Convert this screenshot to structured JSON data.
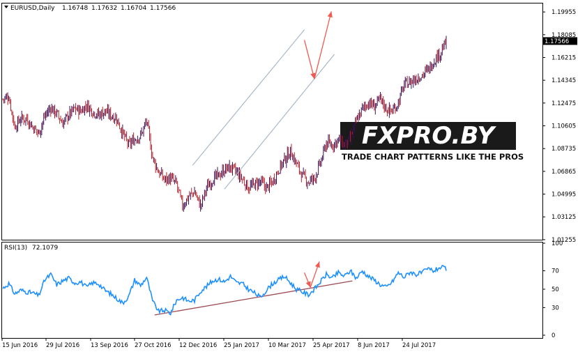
{
  "header": {
    "symbol": "EURUSD,Daily",
    "open": "1.16748",
    "high": "1.17632",
    "low": "1.16704",
    "close": "1.17566"
  },
  "rsi_header": {
    "label": "RSI(13)",
    "value": "72.1079"
  },
  "watermark": {
    "brand": "FXPRO.BY",
    "tagline": "TRADE CHART PATTERNS LIKE THE PROS"
  },
  "colors": {
    "bull": "#3d0f52",
    "bear": "#b0202a",
    "rsi_line": "#1e90ff",
    "channel": "#a9b8c9",
    "arrow": "#f05a50",
    "trendline": "#9c4a52",
    "frame": "#000000"
  },
  "chart_data": [
    {
      "type": "candlestick",
      "title": "EURUSD,Daily",
      "ylim": [
        1.0125,
        1.2065
      ],
      "y_ticks": [
        "1.19955",
        "1.18085",
        "1.16215",
        "1.14345",
        "1.12475",
        "1.10605",
        "1.08735",
        "1.06865",
        "1.04995",
        "1.03125",
        "1.01255"
      ],
      "current_price": "1.17566",
      "x_tick_labels": [
        "15 Jun 2016",
        "29 Jul 2016",
        "13 Sep 2016",
        "27 Oct 2016",
        "12 Dec 2016",
        "25 Jan 2017",
        "10 Mar 2017",
        "25 Apr 2017",
        "8 Jun 2017",
        "24 Jul 2017"
      ],
      "close_path": [
        [
          0,
          1.128
        ],
        [
          6,
          1.13
        ],
        [
          12,
          1.105
        ],
        [
          18,
          1.112
        ],
        [
          24,
          1.112
        ],
        [
          30,
          1.105
        ],
        [
          36,
          1.1
        ],
        [
          42,
          1.114
        ],
        [
          48,
          1.121
        ],
        [
          54,
          1.116
        ],
        [
          60,
          1.108
        ],
        [
          66,
          1.115
        ],
        [
          72,
          1.12
        ],
        [
          78,
          1.118
        ],
        [
          84,
          1.123
        ],
        [
          90,
          1.118
        ],
        [
          96,
          1.115
        ],
        [
          102,
          1.118
        ],
        [
          108,
          1.115
        ],
        [
          114,
          1.112
        ],
        [
          120,
          1.1
        ],
        [
          126,
          1.09
        ],
        [
          132,
          1.095
        ],
        [
          138,
          1.098
        ],
        [
          144,
          1.11
        ],
        [
          150,
          1.08
        ],
        [
          156,
          1.068
        ],
        [
          162,
          1.062
        ],
        [
          168,
          1.063
        ],
        [
          174,
          1.058
        ],
        [
          180,
          1.04
        ],
        [
          186,
          1.048
        ],
        [
          192,
          1.052
        ],
        [
          198,
          1.04
        ],
        [
          204,
          1.055
        ],
        [
          210,
          1.062
        ],
        [
          216,
          1.065
        ],
        [
          222,
          1.07
        ],
        [
          228,
          1.072
        ],
        [
          234,
          1.068
        ],
        [
          240,
          1.062
        ],
        [
          246,
          1.055
        ],
        [
          252,
          1.058
        ],
        [
          258,
          1.06
        ],
        [
          264,
          1.055
        ],
        [
          270,
          1.06
        ],
        [
          276,
          1.07
        ],
        [
          282,
          1.078
        ],
        [
          288,
          1.085
        ],
        [
          294,
          1.075
        ],
        [
          300,
          1.065
        ],
        [
          306,
          1.06
        ],
        [
          312,
          1.063
        ],
        [
          318,
          1.075
        ],
        [
          324,
          1.092
        ],
        [
          330,
          1.09
        ],
        [
          336,
          1.095
        ],
        [
          342,
          1.09
        ],
        [
          348,
          1.095
        ],
        [
          354,
          1.11
        ],
        [
          360,
          1.12
        ],
        [
          366,
          1.125
        ],
        [
          372,
          1.122
        ],
        [
          378,
          1.128
        ],
        [
          384,
          1.12
        ],
        [
          390,
          1.118
        ],
        [
          396,
          1.125
        ],
        [
          402,
          1.14
        ],
        [
          408,
          1.142
        ],
        [
          414,
          1.145
        ],
        [
          420,
          1.148
        ],
        [
          426,
          1.152
        ],
        [
          432,
          1.16
        ],
        [
          438,
          1.166
        ],
        [
          444,
          1.175
        ]
      ],
      "channel": {
        "upper": [
          [
            190,
            1.0736
          ],
          [
            302,
            1.185
          ]
        ],
        "lower": [
          [
            222,
            1.0541
          ],
          [
            332,
            1.1647
          ]
        ]
      },
      "arrows": [
        {
          "from": [
            302,
            1.1765
          ],
          "to": [
            312,
            1.1445
          ]
        },
        {
          "from": [
            312,
            1.1445
          ],
          "to": [
            329,
            1.2
          ]
        }
      ]
    },
    {
      "type": "line",
      "title": "RSI(13) 72.1079",
      "ylim": [
        0,
        100
      ],
      "y_ticks": [
        100,
        70,
        50,
        30,
        0
      ],
      "values": [
        [
          0,
          51
        ],
        [
          6,
          56
        ],
        [
          12,
          45
        ],
        [
          18,
          49
        ],
        [
          24,
          47
        ],
        [
          30,
          46
        ],
        [
          36,
          43
        ],
        [
          42,
          60
        ],
        [
          48,
          66
        ],
        [
          54,
          55
        ],
        [
          60,
          59
        ],
        [
          66,
          62
        ],
        [
          72,
          57
        ],
        [
          78,
          58
        ],
        [
          84,
          52
        ],
        [
          90,
          57
        ],
        [
          96,
          56
        ],
        [
          102,
          49
        ],
        [
          108,
          45
        ],
        [
          114,
          40
        ],
        [
          120,
          35
        ],
        [
          126,
          42
        ],
        [
          132,
          60
        ],
        [
          138,
          54
        ],
        [
          144,
          63
        ],
        [
          150,
          37
        ],
        [
          156,
          26
        ],
        [
          162,
          27
        ],
        [
          168,
          24
        ],
        [
          174,
          38
        ],
        [
          180,
          41
        ],
        [
          186,
          37
        ],
        [
          192,
          38
        ],
        [
          198,
          48
        ],
        [
          204,
          53
        ],
        [
          210,
          59
        ],
        [
          216,
          61
        ],
        [
          222,
          58
        ],
        [
          228,
          64
        ],
        [
          234,
          57
        ],
        [
          240,
          56
        ],
        [
          246,
          50
        ],
        [
          252,
          46
        ],
        [
          258,
          41
        ],
        [
          264,
          49
        ],
        [
          270,
          56
        ],
        [
          276,
          60
        ],
        [
          282,
          64
        ],
        [
          288,
          57
        ],
        [
          294,
          50
        ],
        [
          300,
          47
        ],
        [
          306,
          44
        ],
        [
          312,
          50
        ],
        [
          318,
          58
        ],
        [
          324,
          66
        ],
        [
          330,
          62
        ],
        [
          336,
          68
        ],
        [
          342,
          64
        ],
        [
          348,
          70
        ],
        [
          354,
          62
        ],
        [
          360,
          70
        ],
        [
          366,
          64
        ],
        [
          372,
          60
        ],
        [
          378,
          55
        ],
        [
          384,
          52
        ],
        [
          390,
          58
        ],
        [
          396,
          68
        ],
        [
          402,
          63
        ],
        [
          408,
          69
        ],
        [
          414,
          66
        ],
        [
          420,
          68
        ],
        [
          426,
          72
        ],
        [
          432,
          70
        ],
        [
          438,
          74
        ],
        [
          444,
          72
        ]
      ],
      "trendline": [
        [
          152,
          22
        ],
        [
          350,
          59
        ]
      ],
      "arrows": [
        {
          "from": [
            302,
            68
          ],
          "to": [
            308,
            52
          ]
        },
        {
          "from": [
            308,
            52
          ],
          "to": [
            317,
            80
          ]
        }
      ]
    }
  ]
}
